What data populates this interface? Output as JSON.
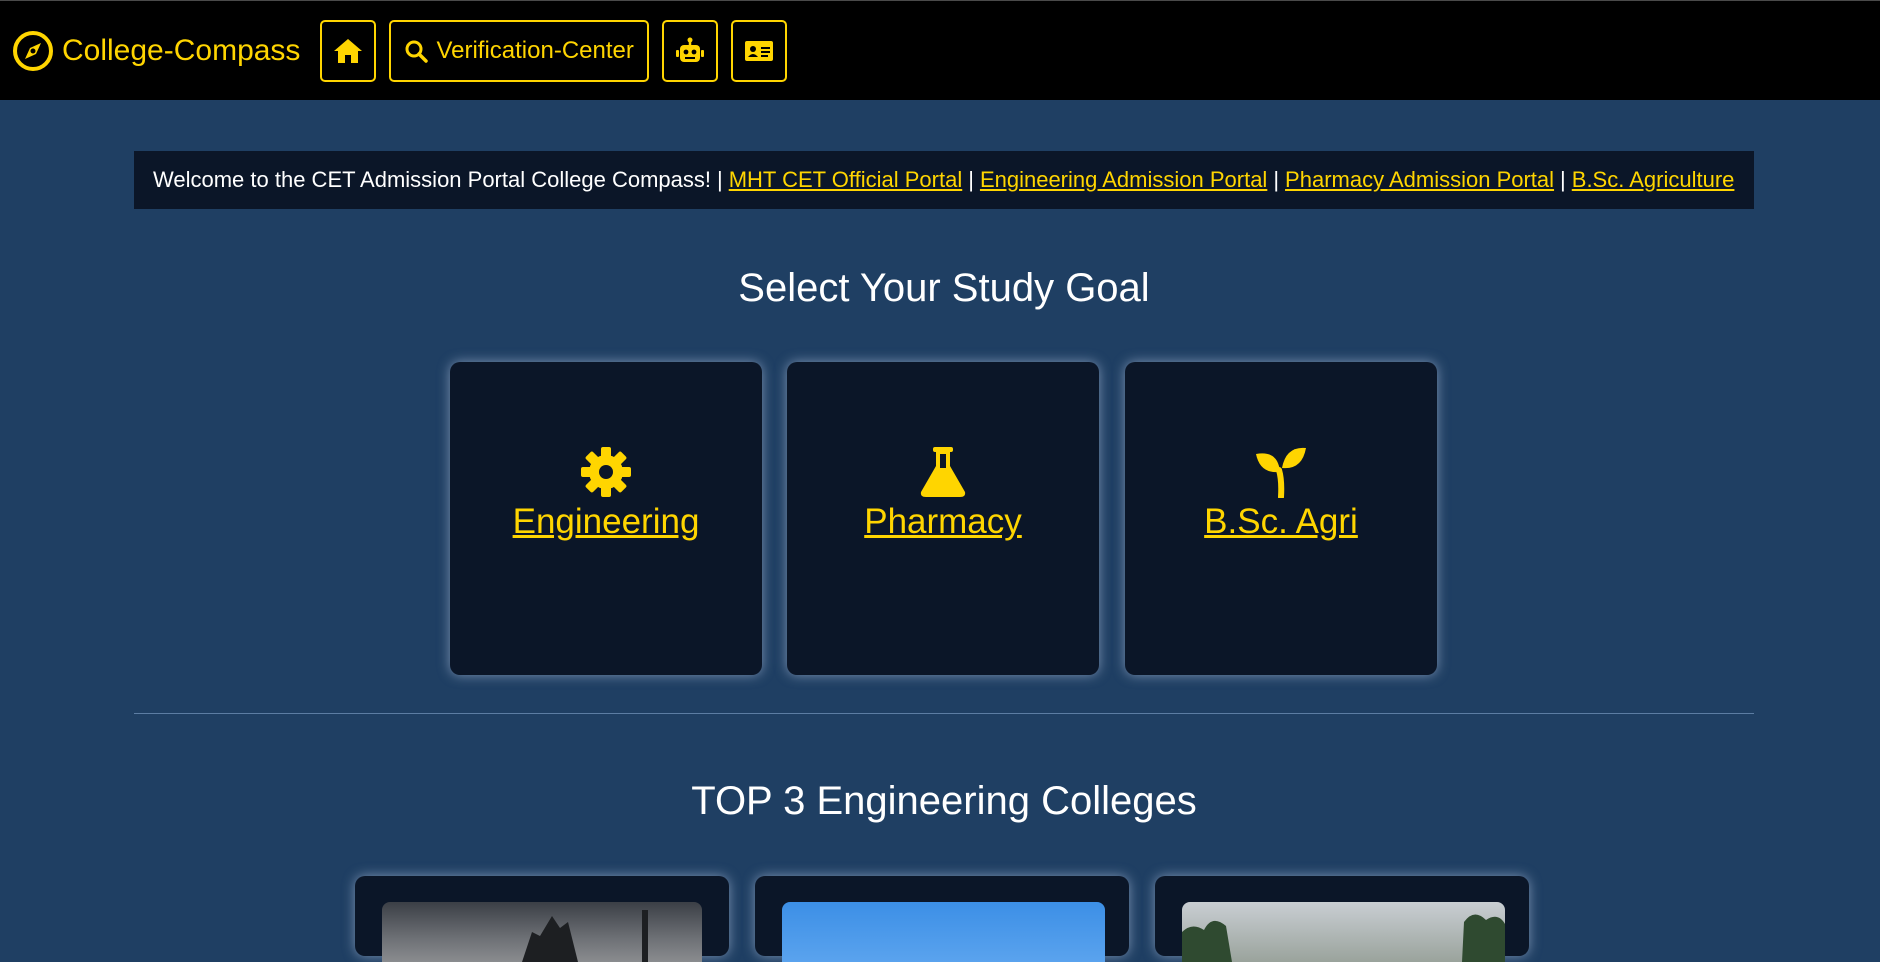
{
  "navbar": {
    "brand": "College-Compass",
    "buttons": [
      {
        "icon": "home-icon"
      },
      {
        "icon": "search-icon",
        "label": "Verification-Center"
      },
      {
        "icon": "robot-icon"
      },
      {
        "icon": "id-card-icon"
      }
    ]
  },
  "ticker": {
    "welcome": "Welcome to the CET Admission Portal College Compass!",
    "separator": "|",
    "links": [
      "MHT CET Official Portal",
      "Engineering Admission Portal",
      "Pharmacy Admission Portal",
      "B.Sc. Agriculture"
    ]
  },
  "study_goal": {
    "title": "Select Your Study Goal",
    "cards": [
      {
        "label": "Engineering",
        "icon": "gear-icon"
      },
      {
        "label": "Pharmacy",
        "icon": "flask-icon"
      },
      {
        "label": "B.Sc. Agri",
        "icon": "seedling-icon"
      }
    ]
  },
  "top_colleges": {
    "title": "TOP 3 Engineering Colleges"
  },
  "colors": {
    "accent": "#ffd500",
    "background": "#1f3f63",
    "card": "#0b1628",
    "navbar": "#000000"
  }
}
